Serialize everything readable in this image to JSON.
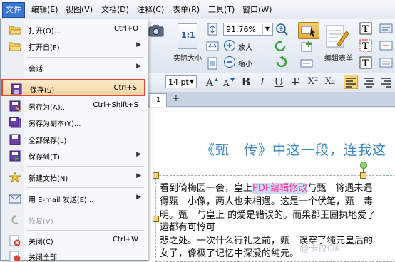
{
  "menubar": {
    "items": [
      "文件",
      "编辑(E)",
      "视图(V)",
      "文档(D)",
      "注释(C)",
      "表单(R)",
      "工具(T)",
      "窗口(W)"
    ]
  },
  "toolbar": {
    "actual_size_label": "实际大小",
    "zoom_value": "91.76%",
    "zoom_in_label": "放大",
    "zoom_out_label": "缩小",
    "edit_form_label": "编辑表单",
    "font_size": "14 pt",
    "actual_size_glyph": "1:1"
  },
  "format": {
    "bold": "B",
    "italic": "I",
    "underline": "U",
    "strike": "T",
    "superscript": "X²",
    "subscript": "X₂"
  },
  "tabs": {
    "doc_tab": "1",
    "new_tab": "+"
  },
  "file_menu": {
    "items": [
      {
        "label": "打开(O)...",
        "shortcut": "Ctrl+O",
        "icon": "folder-open-icon"
      },
      {
        "label": "打开自(F)",
        "arrow": "▶",
        "icon": "folder-open-icon"
      },
      {
        "label": "会话",
        "arrow": "▶",
        "icon": ""
      },
      {
        "label": "保存(S)",
        "shortcut": "Ctrl+S",
        "icon": "save-icon"
      },
      {
        "label": "另存为(A)...",
        "shortcut": "Ctrl+Shift+S",
        "icon": "save-as-icon"
      },
      {
        "label": "另存为副本(Y)...",
        "icon": "save-copy-icon"
      },
      {
        "label": "全部保存(L)",
        "icon": "save-all-icon"
      },
      {
        "label": "保存到(T)",
        "arrow": "▶",
        "icon": "save-to-icon"
      },
      {
        "label": "新建文档(N)",
        "arrow": "▶",
        "icon": "new-document-icon"
      },
      {
        "label": "用 E-mail 发送(E)...",
        "arrow": "▶",
        "icon": "email-icon"
      },
      {
        "label": "恢复(V)",
        "icon": "revert-icon"
      },
      {
        "label": "关闭(C)",
        "shortcut": "Ctrl+W",
        "icon": "close-doc-icon"
      },
      {
        "label": "关闭全部",
        "icon": "close-all-icon"
      }
    ]
  },
  "document": {
    "heading": "《甄　传》中这一段，连我这",
    "line1_pre": "看到倚梅园一会，皇上",
    "line1_hl": "PDF编辑修改",
    "line1_post": "与甄　将遇未遇",
    "line2": "得甄　小像，两人也未相遇。这是一个伏笔，甄　毒",
    "line3": "明。甄　与皇上 的爱是错误的。而果郡王固执地爱了",
    "line4": "运都有可怜可",
    "line5": "悲之处。一次什么行礼之前，甄　误穿了纯元皇后的",
    "line6": "女子，像极了记忆中深爱的纯元。"
  },
  "watermark": "@卡拉OK"
}
